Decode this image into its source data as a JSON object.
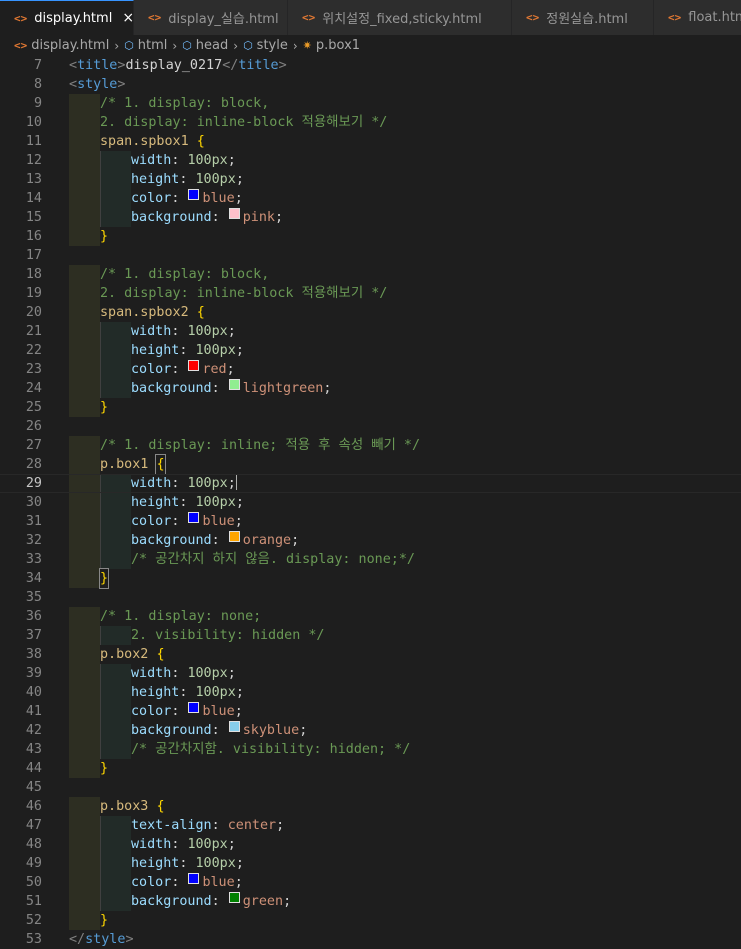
{
  "tabs": [
    {
      "label": "display.html",
      "active": true,
      "icon": "html-file-icon"
    },
    {
      "label": "display_실습.html",
      "active": false,
      "icon": "html-file-icon"
    },
    {
      "label": "위치설정_fixed,sticky.html",
      "active": false,
      "icon": "html-file-icon"
    },
    {
      "label": "정원실습.html",
      "active": false,
      "icon": "html-file-icon"
    },
    {
      "label": "float.html",
      "active": false,
      "icon": "html-file-icon"
    }
  ],
  "tab_icon_glyph": "<>",
  "tab_close_glyph": "×",
  "breadcrumb": [
    {
      "label": "display.html",
      "icon": "html-file-icon"
    },
    {
      "label": "html",
      "icon": "element-icon"
    },
    {
      "label": "head",
      "icon": "element-icon"
    },
    {
      "label": "style",
      "icon": "element-icon"
    },
    {
      "label": "p.box1",
      "icon": "symbol-icon"
    }
  ],
  "breadcrumb_sep": "›",
  "current_line": 29,
  "lines": [
    {
      "n": "7",
      "tokens": [
        [
          "tag",
          "<"
        ],
        [
          "tagname",
          "title"
        ],
        [
          "tag",
          ">"
        ],
        [
          "text",
          "display_0217"
        ],
        [
          "tag",
          "</"
        ],
        [
          "tagname",
          "title"
        ],
        [
          "tag",
          ">"
        ]
      ],
      "indent": 1
    },
    {
      "n": "8",
      "tokens": [
        [
          "tag",
          "<"
        ],
        [
          "tagname",
          "style"
        ],
        [
          "tag",
          ">"
        ]
      ],
      "indent": 1
    },
    {
      "n": "9",
      "tokens": [
        [
          "comment",
          "/* 1. display: block,"
        ]
      ],
      "indent": 2
    },
    {
      "n": "10",
      "tokens": [
        [
          "comment",
          "2. display: inline-block 적용해보기 */"
        ]
      ],
      "indent": 2
    },
    {
      "n": "11",
      "tokens": [
        [
          "sel",
          "span.spbox1 "
        ],
        [
          "brace",
          "{"
        ]
      ],
      "indent": 2
    },
    {
      "n": "12",
      "tokens": [
        [
          "prop",
          "width"
        ],
        [
          "punc",
          ": "
        ],
        [
          "num",
          "100px"
        ],
        [
          "punc",
          ";"
        ]
      ],
      "indent": 3
    },
    {
      "n": "13",
      "tokens": [
        [
          "prop",
          "height"
        ],
        [
          "punc",
          ": "
        ],
        [
          "num",
          "100px"
        ],
        [
          "punc",
          ";"
        ]
      ],
      "indent": 3
    },
    {
      "n": "14",
      "tokens": [
        [
          "prop",
          "color"
        ],
        [
          "punc",
          ": "
        ],
        [
          "swatch",
          "#0000ff"
        ],
        [
          "val",
          "blue"
        ],
        [
          "punc",
          ";"
        ]
      ],
      "indent": 3
    },
    {
      "n": "15",
      "tokens": [
        [
          "prop",
          "background"
        ],
        [
          "punc",
          ": "
        ],
        [
          "swatch",
          "#ffc0cb"
        ],
        [
          "val",
          "pink"
        ],
        [
          "punc",
          ";"
        ]
      ],
      "indent": 3
    },
    {
      "n": "16",
      "tokens": [
        [
          "brace",
          "}"
        ]
      ],
      "indent": 2
    },
    {
      "n": "17",
      "tokens": [],
      "indent": 1
    },
    {
      "n": "18",
      "tokens": [
        [
          "comment",
          "/* 1. display: block,"
        ]
      ],
      "indent": 2
    },
    {
      "n": "19",
      "tokens": [
        [
          "comment",
          "2. display: inline-block 적용해보기 */"
        ]
      ],
      "indent": 2
    },
    {
      "n": "20",
      "tokens": [
        [
          "sel",
          "span.spbox2 "
        ],
        [
          "brace",
          "{"
        ]
      ],
      "indent": 2
    },
    {
      "n": "21",
      "tokens": [
        [
          "prop",
          "width"
        ],
        [
          "punc",
          ": "
        ],
        [
          "num",
          "100px"
        ],
        [
          "punc",
          ";"
        ]
      ],
      "indent": 3
    },
    {
      "n": "22",
      "tokens": [
        [
          "prop",
          "height"
        ],
        [
          "punc",
          ": "
        ],
        [
          "num",
          "100px"
        ],
        [
          "punc",
          ";"
        ]
      ],
      "indent": 3
    },
    {
      "n": "23",
      "tokens": [
        [
          "prop",
          "color"
        ],
        [
          "punc",
          ": "
        ],
        [
          "swatch",
          "#ff0000"
        ],
        [
          "val",
          "red"
        ],
        [
          "punc",
          ";"
        ]
      ],
      "indent": 3
    },
    {
      "n": "24",
      "tokens": [
        [
          "prop",
          "background"
        ],
        [
          "punc",
          ": "
        ],
        [
          "swatch",
          "#90ee90"
        ],
        [
          "val",
          "lightgreen"
        ],
        [
          "punc",
          ";"
        ]
      ],
      "indent": 3
    },
    {
      "n": "25",
      "tokens": [
        [
          "brace",
          "}"
        ]
      ],
      "indent": 2
    },
    {
      "n": "26",
      "tokens": [],
      "indent": 1
    },
    {
      "n": "27",
      "tokens": [
        [
          "comment",
          "/* 1. display: inline; 적용 후 속성 빼기 */"
        ]
      ],
      "indent": 2
    },
    {
      "n": "28",
      "tokens": [
        [
          "sel",
          "p.box1 "
        ],
        [
          "bracehl",
          "{"
        ]
      ],
      "indent": 2
    },
    {
      "n": "29",
      "tokens": [
        [
          "prop",
          "width"
        ],
        [
          "punc",
          ": "
        ],
        [
          "num",
          "100px"
        ],
        [
          "punc",
          ";"
        ],
        [
          "cursor",
          ""
        ]
      ],
      "indent": 3
    },
    {
      "n": "30",
      "tokens": [
        [
          "prop",
          "height"
        ],
        [
          "punc",
          ": "
        ],
        [
          "num",
          "100px"
        ],
        [
          "punc",
          ";"
        ]
      ],
      "indent": 3
    },
    {
      "n": "31",
      "tokens": [
        [
          "prop",
          "color"
        ],
        [
          "punc",
          ": "
        ],
        [
          "swatch",
          "#0000ff"
        ],
        [
          "val",
          "blue"
        ],
        [
          "punc",
          ";"
        ]
      ],
      "indent": 3
    },
    {
      "n": "32",
      "tokens": [
        [
          "prop",
          "background"
        ],
        [
          "punc",
          ": "
        ],
        [
          "swatch",
          "#ffa500"
        ],
        [
          "val",
          "orange"
        ],
        [
          "punc",
          ";"
        ]
      ],
      "indent": 3
    },
    {
      "n": "33",
      "tokens": [
        [
          "comment",
          "/* 공간차지 하지 않음. display: none;*/"
        ]
      ],
      "indent": 3
    },
    {
      "n": "34",
      "tokens": [
        [
          "bracehl",
          "}"
        ]
      ],
      "indent": 2
    },
    {
      "n": "35",
      "tokens": [],
      "indent": 1
    },
    {
      "n": "36",
      "tokens": [
        [
          "comment",
          "/* 1. display: none;"
        ]
      ],
      "indent": 2
    },
    {
      "n": "37",
      "tokens": [
        [
          "comment",
          "2. visibility: hidden */"
        ]
      ],
      "indent": 3
    },
    {
      "n": "38",
      "tokens": [
        [
          "sel",
          "p.box2 "
        ],
        [
          "brace",
          "{"
        ]
      ],
      "indent": 2
    },
    {
      "n": "39",
      "tokens": [
        [
          "prop",
          "width"
        ],
        [
          "punc",
          ": "
        ],
        [
          "num",
          "100px"
        ],
        [
          "punc",
          ";"
        ]
      ],
      "indent": 3
    },
    {
      "n": "40",
      "tokens": [
        [
          "prop",
          "height"
        ],
        [
          "punc",
          ": "
        ],
        [
          "num",
          "100px"
        ],
        [
          "punc",
          ";"
        ]
      ],
      "indent": 3
    },
    {
      "n": "41",
      "tokens": [
        [
          "prop",
          "color"
        ],
        [
          "punc",
          ": "
        ],
        [
          "swatch",
          "#0000ff"
        ],
        [
          "val",
          "blue"
        ],
        [
          "punc",
          ";"
        ]
      ],
      "indent": 3
    },
    {
      "n": "42",
      "tokens": [
        [
          "prop",
          "background"
        ],
        [
          "punc",
          ": "
        ],
        [
          "swatch",
          "#87ceeb"
        ],
        [
          "val",
          "skyblue"
        ],
        [
          "punc",
          ";"
        ]
      ],
      "indent": 3
    },
    {
      "n": "43",
      "tokens": [
        [
          "comment",
          "/* 공간차지함. visibility: hidden; */"
        ]
      ],
      "indent": 3
    },
    {
      "n": "44",
      "tokens": [
        [
          "brace",
          "}"
        ]
      ],
      "indent": 2
    },
    {
      "n": "45",
      "tokens": [],
      "indent": 1
    },
    {
      "n": "46",
      "tokens": [
        [
          "sel",
          "p.box3 "
        ],
        [
          "brace",
          "{"
        ]
      ],
      "indent": 2
    },
    {
      "n": "47",
      "tokens": [
        [
          "prop",
          "text-align"
        ],
        [
          "punc",
          ": "
        ],
        [
          "val",
          "center"
        ],
        [
          "punc",
          ";"
        ]
      ],
      "indent": 3
    },
    {
      "n": "48",
      "tokens": [
        [
          "prop",
          "width"
        ],
        [
          "punc",
          ": "
        ],
        [
          "num",
          "100px"
        ],
        [
          "punc",
          ";"
        ]
      ],
      "indent": 3
    },
    {
      "n": "49",
      "tokens": [
        [
          "prop",
          "height"
        ],
        [
          "punc",
          ": "
        ],
        [
          "num",
          "100px"
        ],
        [
          "punc",
          ";"
        ]
      ],
      "indent": 3
    },
    {
      "n": "50",
      "tokens": [
        [
          "prop",
          "color"
        ],
        [
          "punc",
          ": "
        ],
        [
          "swatch",
          "#0000ff"
        ],
        [
          "val",
          "blue"
        ],
        [
          "punc",
          ";"
        ]
      ],
      "indent": 3
    },
    {
      "n": "51",
      "tokens": [
        [
          "prop",
          "background"
        ],
        [
          "punc",
          ": "
        ],
        [
          "swatch",
          "#008000"
        ],
        [
          "val",
          "green"
        ],
        [
          "punc",
          ";"
        ]
      ],
      "indent": 3
    },
    {
      "n": "52",
      "tokens": [
        [
          "brace",
          "}"
        ]
      ],
      "indent": 2
    },
    {
      "n": "53",
      "tokens": [
        [
          "tag",
          "</"
        ],
        [
          "tagname",
          "style"
        ],
        [
          "tag",
          ">"
        ]
      ],
      "indent": 1
    }
  ]
}
